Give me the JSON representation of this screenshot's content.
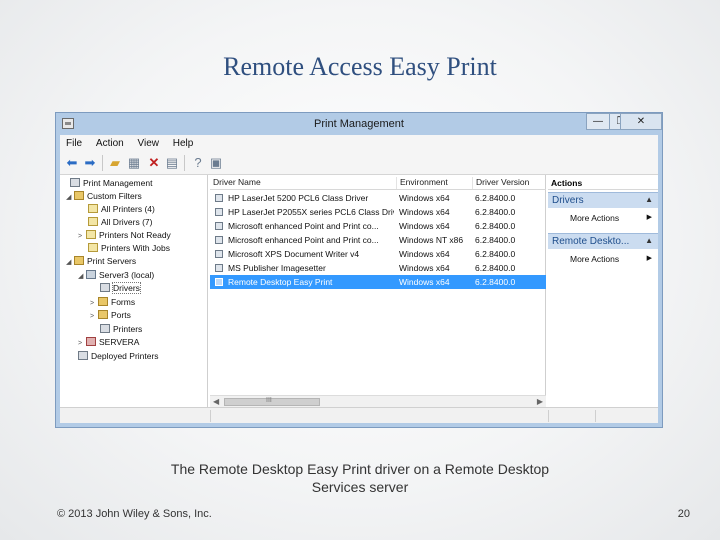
{
  "slide": {
    "title": "Remote Access Easy Print",
    "caption_line1": "The Remote Desktop Easy Print driver on a Remote Desktop",
    "caption_line2": "Services server",
    "copyright": "© 2013 John Wiley & Sons, Inc.",
    "page_number": "20"
  },
  "window": {
    "title": "Print Management",
    "minimize": "—",
    "restore": "❐",
    "close": "✕"
  },
  "menu": [
    "File",
    "Action",
    "View",
    "Help"
  ],
  "toolbar_icons": [
    "back-arrow-icon",
    "forward-arrow-icon",
    "up-folder-icon",
    "show-tree-icon",
    "delete-icon",
    "export-icon",
    "help-icon",
    "properties-icon"
  ],
  "tree": [
    {
      "label": "Print Management",
      "icon": "console-icon",
      "toggle": ""
    },
    {
      "label": "Custom Filters",
      "icon": "folder-icon",
      "toggle": "◢"
    },
    {
      "label": "All Printers (4)",
      "icon": "filter-icon",
      "toggle": ""
    },
    {
      "label": "All Drivers (7)",
      "icon": "filter-icon",
      "toggle": ""
    },
    {
      "label": "Printers Not Ready",
      "icon": "filter-icon",
      "toggle": ">"
    },
    {
      "label": "Printers With Jobs",
      "icon": "filter-icon",
      "toggle": ""
    },
    {
      "label": "Print Servers",
      "icon": "folder-icon",
      "toggle": "◢"
    },
    {
      "label": "Server3 (local)",
      "icon": "server-icon",
      "toggle": "◢"
    },
    {
      "label": "Drivers",
      "icon": "printer-icon",
      "toggle": ""
    },
    {
      "label": "Forms",
      "icon": "folder-icon",
      "toggle": ">"
    },
    {
      "label": "Ports",
      "icon": "folder-icon",
      "toggle": ">"
    },
    {
      "label": "Printers",
      "icon": "printer-icon",
      "toggle": ""
    },
    {
      "label": "SERVERA",
      "icon": "red-server-icon",
      "toggle": ">"
    },
    {
      "label": "Deployed Printers",
      "icon": "printer-icon",
      "toggle": ""
    }
  ],
  "columns": [
    "Driver Name",
    "Environment",
    "Driver Version"
  ],
  "drivers": [
    {
      "name": "HP LaserJet 5200 PCL6 Class Driver",
      "env": "Windows x64",
      "ver": "6.2.8400.0"
    },
    {
      "name": "HP LaserJet P2055X series PCL6 Class Driv...",
      "env": "Windows x64",
      "ver": "6.2.8400.0"
    },
    {
      "name": "Microsoft enhanced Point and Print co...",
      "env": "Windows x64",
      "ver": "6.2.8400.0"
    },
    {
      "name": "Microsoft enhanced Point and Print co...",
      "env": "Windows NT x86",
      "ver": "6.2.8400.0"
    },
    {
      "name": "Microsoft XPS Document Writer v4",
      "env": "Windows x64",
      "ver": "6.2.8400.0"
    },
    {
      "name": "MS Publisher Imagesetter",
      "env": "Windows x64",
      "ver": "6.2.8400.0"
    },
    {
      "name": "Remote Desktop Easy Print",
      "env": "Windows x64",
      "ver": "6.2.8400.0"
    }
  ],
  "scrollbar": {
    "left": "◀",
    "right": "▶",
    "grip": "III"
  },
  "actions": {
    "header": "Actions",
    "section1": "Drivers",
    "section1_item": "More Actions",
    "section2": "Remote Deskto...",
    "section2_item": "More Actions"
  }
}
